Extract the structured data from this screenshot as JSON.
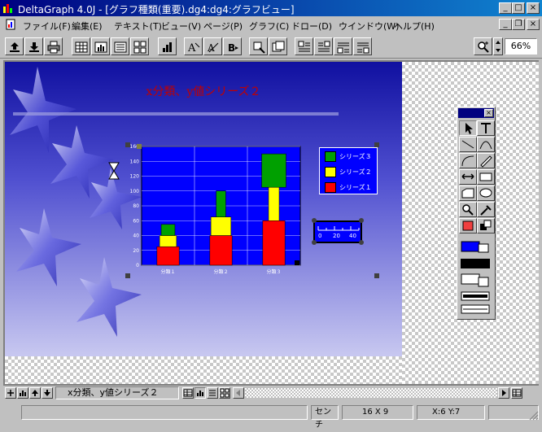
{
  "window": {
    "title": "DeltaGraph 4.0J - [グラフ種類(重要).dg4:dg4:グラフビュー]"
  },
  "menu": [
    {
      "label": "ファイル(F)"
    },
    {
      "label": "編集(E)"
    },
    {
      "label": "テキスト(T)"
    },
    {
      "label": "ビュー(V)"
    },
    {
      "label": "ページ(P)"
    },
    {
      "label": "グラフ(C)"
    },
    {
      "label": "ドロー(D)"
    },
    {
      "label": "ウインドウ(W)"
    },
    {
      "label": "ヘルプ(H)"
    }
  ],
  "toolbar": {
    "zoom_value": "66%"
  },
  "graph": {
    "title": "x分類、y値シリーズ２"
  },
  "chart_data": {
    "type": "bar",
    "categories": [
      "分類１",
      "分類２",
      "分類３"
    ],
    "yticks": [
      0,
      20,
      40,
      60,
      80,
      100,
      120,
      140,
      160
    ],
    "ylim": [
      0,
      160
    ],
    "series": [
      {
        "name": "シリーズ１",
        "color": "#ff0000",
        "values": [
          25,
          40,
          60
        ]
      },
      {
        "name": "シリーズ２",
        "color": "#ffff00",
        "values": [
          15,
          25,
          45
        ]
      },
      {
        "name": "シリーズ３",
        "color": "#00a000",
        "values": [
          15,
          35,
          45
        ]
      }
    ],
    "legend": [
      "シリーズ３",
      "シリーズ２",
      "シリーズ１"
    ],
    "grid": true
  },
  "scale_widget": {
    "labels": [
      "0",
      "20",
      "40"
    ]
  },
  "tabbar": {
    "sheet_label": "x分類、y値シリーズ２"
  },
  "status": {
    "unit": "センチ",
    "grid": "16 X 9",
    "coords": "X:6  Y:7"
  },
  "colors": {
    "accent": "#000080",
    "canvas_top": "#1010a0",
    "plot_bg": "#0000ff"
  }
}
